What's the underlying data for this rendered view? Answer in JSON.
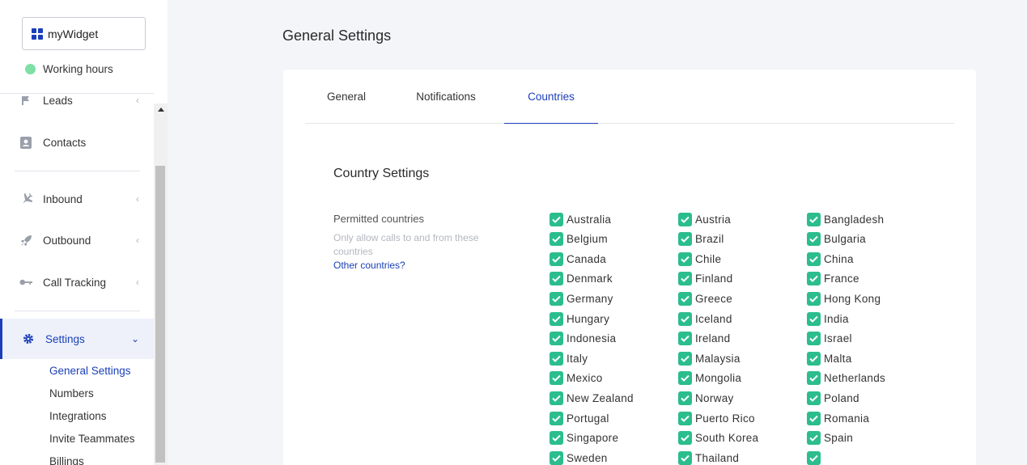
{
  "sidebar": {
    "widget_name": "myWidget",
    "working_hours": "Working hours",
    "nav": {
      "leads": "Leads",
      "contacts": "Contacts",
      "inbound": "Inbound",
      "outbound": "Outbound",
      "call_tracking": "Call Tracking",
      "settings": "Settings"
    },
    "sub_items": [
      "General Settings",
      "Numbers",
      "Integrations",
      "Invite Teammates",
      "Billings"
    ]
  },
  "page": {
    "title": "General Settings",
    "tabs": [
      "General",
      "Notifications",
      "Countries"
    ],
    "active_tab": "Countries",
    "section_title": "Country Settings",
    "permitted_label": "Permitted countries",
    "permitted_help": "Only allow calls to and from these countries",
    "other_link": "Other countries?"
  },
  "countries": {
    "col1": [
      "Australia",
      "Belgium",
      "Canada",
      "Denmark",
      "Germany",
      "Hungary",
      "Indonesia",
      "Italy",
      "Mexico",
      "New Zealand",
      "Portugal",
      "Singapore",
      "Sweden"
    ],
    "col2": [
      "Austria",
      "Brazil",
      "Chile",
      "Finland",
      "Greece",
      "Iceland",
      "Ireland",
      "Malaysia",
      "Mongolia",
      "Norway",
      "Puerto Rico",
      "South Korea",
      "Thailand"
    ],
    "col3": [
      "Bangladesh",
      "Bulgaria",
      "China",
      "France",
      "Hong Kong",
      "India",
      "Israel",
      "Malta",
      "Netherlands",
      "Poland",
      "Romania",
      "Spain",
      ""
    ]
  },
  "colors": {
    "accent": "#1a3fb8",
    "check": "#2bbd8e",
    "status_dot": "#7ee0a6"
  }
}
